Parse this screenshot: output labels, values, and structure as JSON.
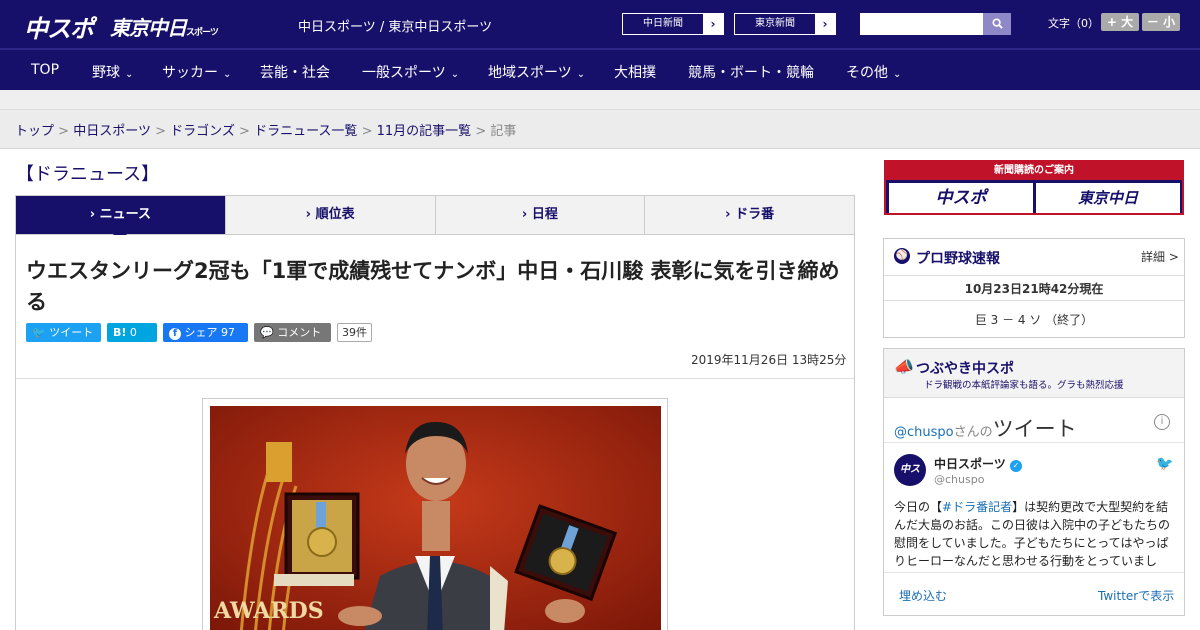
{
  "header": {
    "logo_chuspo": "中スポ",
    "logo_tokyo": "東京中日",
    "logo_tokyo_small": "スポーツ",
    "site_name": "中日スポーツ / 東京中日スポーツ",
    "ext_links": [
      {
        "label": "中日新聞",
        "arrow": "›"
      },
      {
        "label": "東京新聞",
        "arrow": "›"
      }
    ],
    "search": {
      "value": "",
      "button_icon": "search-icon"
    },
    "font_size_label": "文字（0）",
    "font_bigger": "+ 大",
    "font_smaller": "－ 小"
  },
  "nav": {
    "items": [
      {
        "label": "TOP",
        "has_menu": false
      },
      {
        "label": "野球",
        "has_menu": true
      },
      {
        "label": "サッカー",
        "has_menu": true
      },
      {
        "label": "芸能・社会",
        "has_menu": false
      },
      {
        "label": "一般スポーツ",
        "has_menu": true
      },
      {
        "label": "地域スポーツ",
        "has_menu": true
      },
      {
        "label": "大相撲",
        "has_menu": false
      },
      {
        "label": "競馬・ボート・競輪",
        "has_menu": false
      },
      {
        "label": "その他",
        "has_menu": true
      }
    ],
    "chevron": "⌄"
  },
  "breadcrumb": {
    "items": [
      "トップ",
      "中日スポーツ",
      "ドラゴンズ",
      "ドラニュース一覧",
      "11月の記事一覧"
    ],
    "current": "記事",
    "separator": ">"
  },
  "section_title": "【ドラニュース】",
  "tabs": [
    {
      "label": "ニュース",
      "active": true
    },
    {
      "label": "順位表",
      "active": false
    },
    {
      "label": "日程",
      "active": false
    },
    {
      "label": "ドラ番",
      "active": false
    }
  ],
  "tab_marker": "›",
  "article": {
    "headline": "ウエスタンリーグ2冠も「1軍で成績残せてナンボ」中日・石川駿 表彰に気を引き締める",
    "social": {
      "tweet": "ツイート",
      "hatena": "B!",
      "hatena_count": "0",
      "share": "シェア",
      "share_count": "97",
      "comment": "コメント",
      "comment_count": "39件"
    },
    "date": "2019年11月26日 13時25分",
    "photo_text": "AWARDS"
  },
  "sidebar": {
    "subscribe": {
      "header": "新聞購読のご案内",
      "chuspo": "中スポ",
      "tokyo": "東京中日"
    },
    "scores": {
      "title": "プロ野球速報",
      "detail": "詳細 >",
      "time": "10月23日21時42分現在",
      "result": "巨 3 － 4 ソ （終了）"
    },
    "tweets": {
      "title": "つぶやき中スポ",
      "subtitle": "ドラ観戦の本紙評論家も語る。グラも熱烈応援",
      "handle_prefix": "@chuspo",
      "handle_suffix": "さんの",
      "heading": "ツイート",
      "account_name": "中日スポーツ",
      "account_handle": "@chuspo",
      "tweet_text_pre": "今日の【",
      "tweet_hashtag": "#ドラ番記者",
      "tweet_text_post": "】は契約更改で大型契約を結んだ大島のお話。この日彼は入院中の子どもたちの慰問をしていました。子どもたちにとってはやっぱりヒーローなんだと思わせる行動をとっていまし",
      "embed": "埋め込む",
      "view_on_twitter": "Twitterで表示"
    }
  },
  "colors": {
    "brand": "#17106a",
    "accent_red": "#c0132a",
    "twitter": "#1da1f2",
    "facebook": "#1877f2",
    "hatena": "#00a4de"
  }
}
